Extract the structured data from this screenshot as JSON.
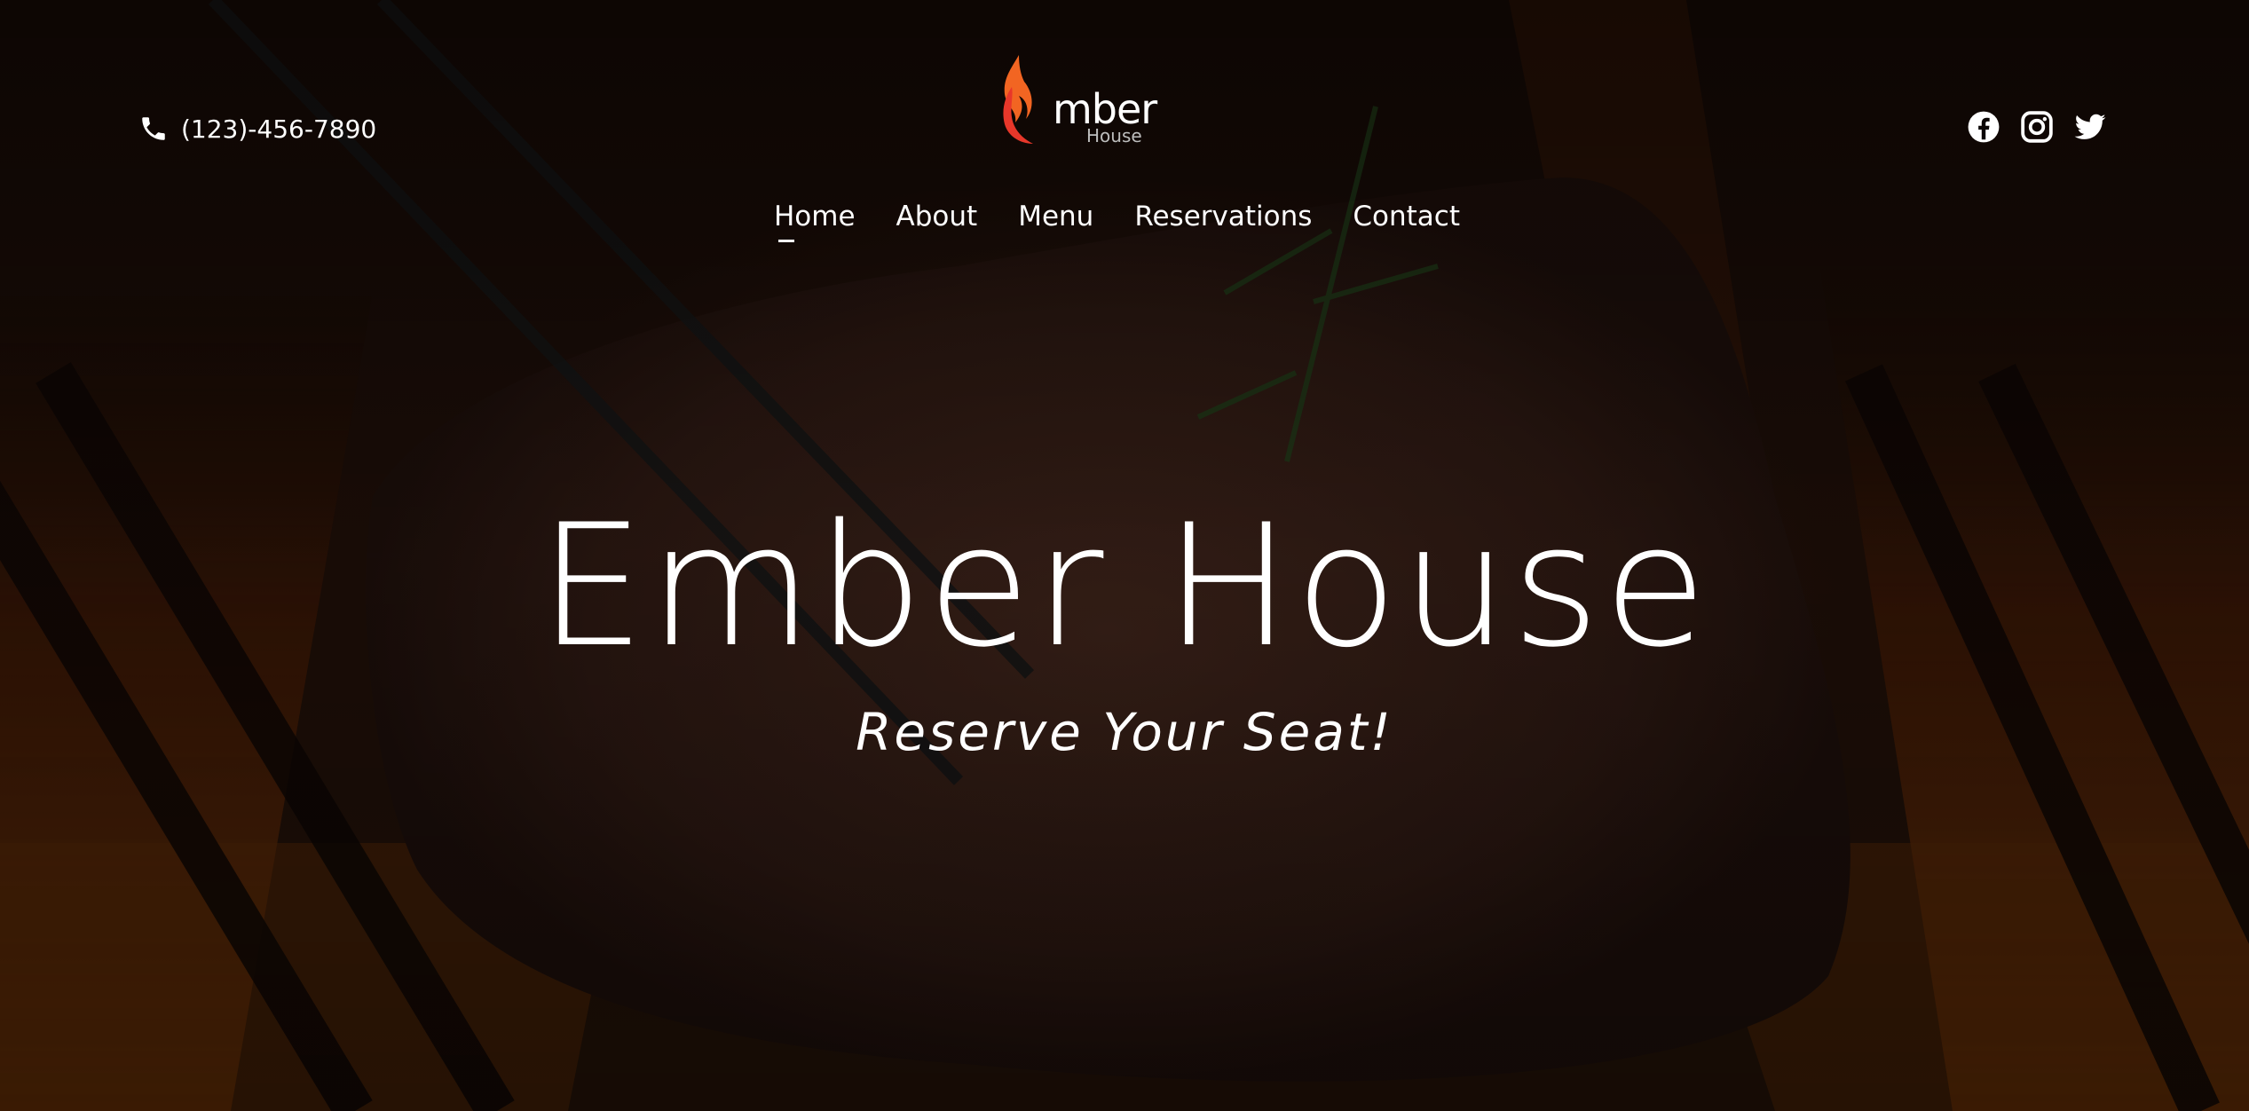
{
  "header": {
    "phone": {
      "icon": "phone-icon",
      "number": "(123)-456-7890"
    },
    "logo": {
      "main_text": "mber",
      "sub_text": "House",
      "icon": "flame-icon",
      "accent_color": "#e8372a"
    },
    "social": [
      {
        "name": "facebook",
        "icon": "facebook-icon"
      },
      {
        "name": "instagram",
        "icon": "instagram-icon"
      },
      {
        "name": "twitter",
        "icon": "twitter-icon"
      }
    ]
  },
  "nav": {
    "items": [
      {
        "label": "Home",
        "active": true
      },
      {
        "label": "About",
        "active": false
      },
      {
        "label": "Menu",
        "active": false
      },
      {
        "label": "Reservations",
        "active": false
      },
      {
        "label": "Contact",
        "active": false
      }
    ]
  },
  "hero": {
    "title": "Ember House",
    "subtitle": "Reserve Your Seat!",
    "background": "grilled-steak-flames-image"
  }
}
